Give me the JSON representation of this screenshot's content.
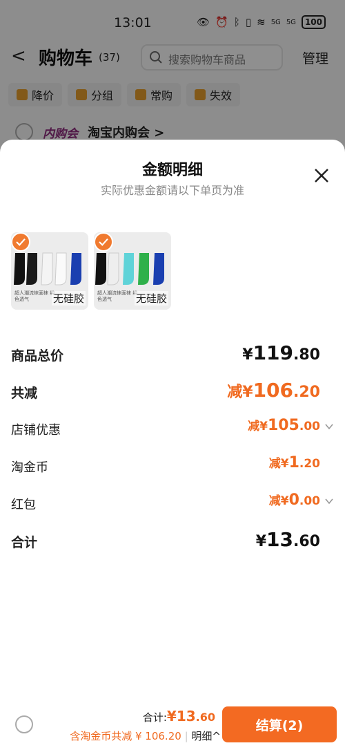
{
  "status": {
    "time": "13:01",
    "battery": "100",
    "signal1": "5G",
    "signal2": "5G"
  },
  "header": {
    "back": "<",
    "title": "购物车",
    "count": "(37)",
    "search_placeholder": "搜索购物车商品",
    "manage": "管理"
  },
  "chips": [
    {
      "label": "降价",
      "icon": "price-drop-icon"
    },
    {
      "label": "分组",
      "icon": "folder-icon"
    },
    {
      "label": "常购",
      "icon": "cart-icon"
    },
    {
      "label": "失效",
      "icon": "expired-icon"
    }
  ],
  "shop": {
    "logo": "内购会",
    "name": "淘宝内购会 >"
  },
  "sheet": {
    "title": "金额明细",
    "subtitle": "实际优惠金额请以下单页为准",
    "thumbs": [
      {
        "label": "无硅胶",
        "caption": "超人潮流袜面袜 纯色透气"
      },
      {
        "label": "无硅胶",
        "caption": "超人潮流袜面袜 纯色透气"
      }
    ],
    "rows": {
      "total_price": {
        "label": "商品总价",
        "prefix": "¥",
        "int": "119",
        "dec": ".80"
      },
      "total_discount": {
        "label": "共减",
        "prefix": "减¥",
        "int": "106",
        "dec": ".20"
      },
      "shop_discount": {
        "label": "店铺优惠",
        "prefix": "减¥",
        "int": "105",
        "dec": ".00"
      },
      "taojinbi": {
        "label": "淘金币",
        "prefix": "减¥",
        "int": "1",
        "dec": ".20"
      },
      "redpacket": {
        "label": "红包",
        "prefix": "减¥",
        "int": "0",
        "dec": ".00"
      },
      "sum": {
        "label": "合计",
        "prefix": "¥",
        "int": "13",
        "dec": ".60"
      }
    }
  },
  "bottom": {
    "total_label": "合计:",
    "total_prefix": "¥",
    "total_int": "13",
    "total_dec": ".60",
    "saving": "含淘金币共减 ¥ 106.20",
    "detail": "明细^",
    "checkout": "结算(2)"
  },
  "colors": {
    "accent": "#f06a20",
    "button": "#f36a22"
  }
}
